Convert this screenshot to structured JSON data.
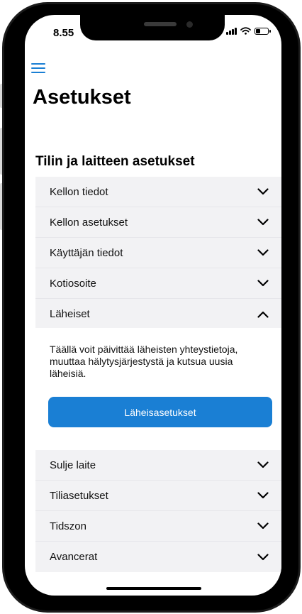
{
  "status_bar": {
    "time": "8.55"
  },
  "header": {
    "title": "Asetukset"
  },
  "section": {
    "title": "Tilin ja laitteen asetukset"
  },
  "accordion_top": [
    {
      "label": "Kellon tiedot",
      "expanded": false
    },
    {
      "label": "Kellon asetukset",
      "expanded": false
    },
    {
      "label": "Käyttäjän tiedot",
      "expanded": false
    },
    {
      "label": "Kotiosoite",
      "expanded": false
    },
    {
      "label": "Läheiset",
      "expanded": true
    }
  ],
  "expanded_panel": {
    "text": "Täällä voit päivittää läheisten yhteystietoja, muuttaa hälytysjärjestystä ja kutsua uusia läheisiä.",
    "button_label": "Läheisasetukset"
  },
  "accordion_bottom": [
    {
      "label": "Sulje laite",
      "expanded": false
    },
    {
      "label": "Tiliasetukset",
      "expanded": false
    },
    {
      "label": "Tidszon",
      "expanded": false
    },
    {
      "label": "Avancerat",
      "expanded": false
    }
  ],
  "colors": {
    "accent": "#1a7fd4",
    "row_background": "#f2f2f4"
  },
  "icons": {
    "menu": "hamburger-menu-icon",
    "collapsed": "chevron-down-icon",
    "expanded": "chevron-up-icon"
  }
}
